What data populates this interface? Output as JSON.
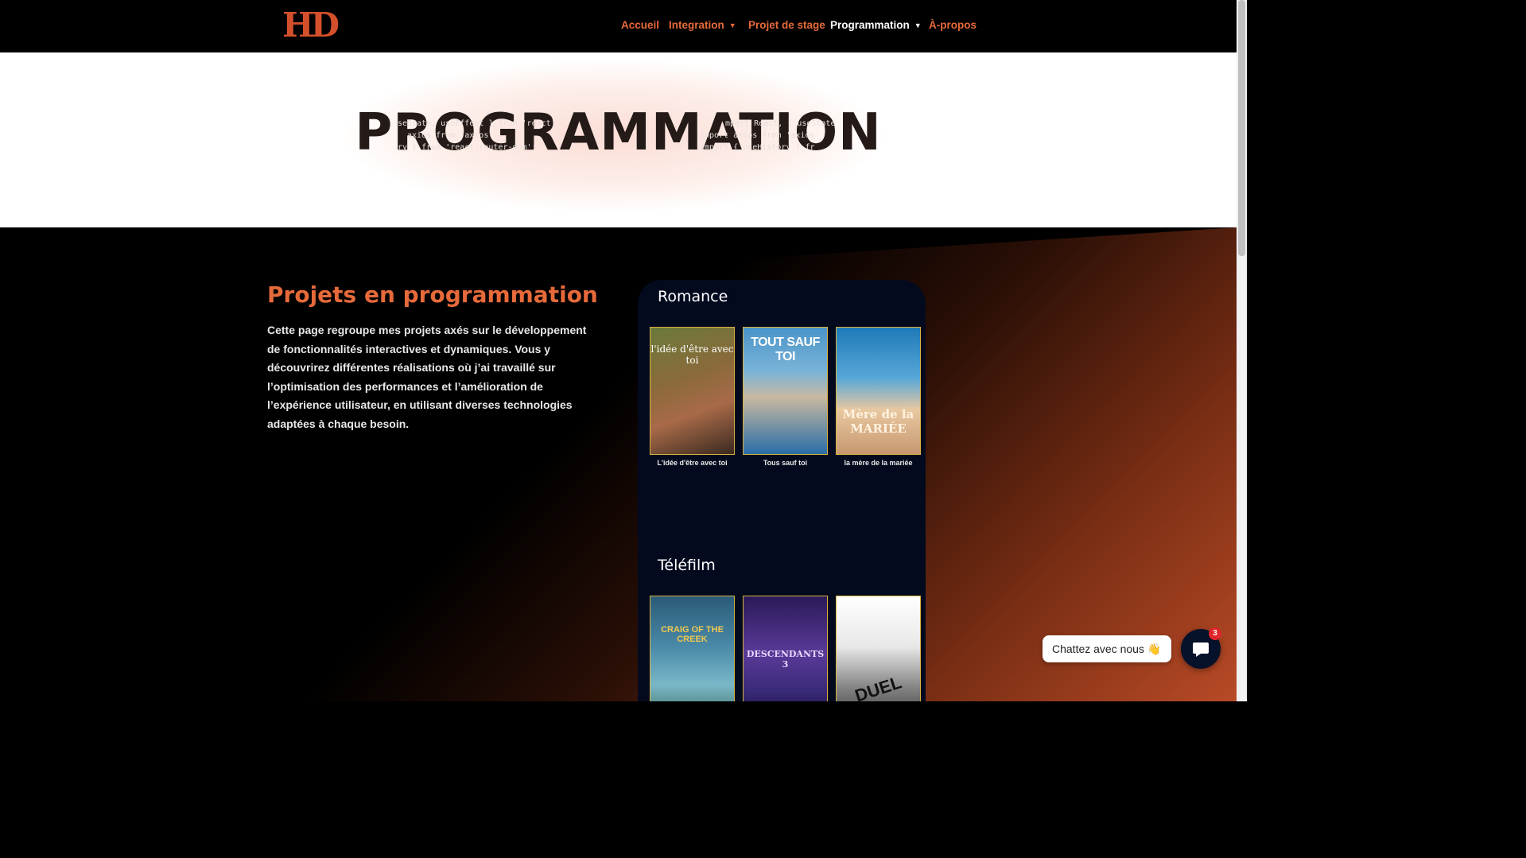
{
  "header": {
    "logo": "HD",
    "nav": [
      {
        "label": "Accueil",
        "has_dropdown": false,
        "active": false
      },
      {
        "label": "Integration",
        "has_dropdown": true,
        "active": false
      },
      {
        "label": "Projet de stage",
        "has_dropdown": false,
        "active": false
      },
      {
        "label": "Programmation",
        "has_dropdown": true,
        "active": true
      },
      {
        "label": "À-propos",
        "has_dropdown": false,
        "active": false
      }
    ]
  },
  "hero": {
    "title": "PROGRAMMATION",
    "code_lines": [
      "seState, useEffect } from 'react'",
      "axios from 'axios'",
      "ry } from 'react-router-dom';",
      "mport React, { useState",
      "import axios from 'axios'",
      "import { useHistory } fr"
    ]
  },
  "section": {
    "title": "Projets en programmation",
    "description": "Cette page regroupe mes projets axés sur le développement de fonctionnalités interactives et dynamiques. Vous y découvrirez différentes réalisations où j’ai travaillé sur l’optimisation des performances et l’amélioration de l’expérience utilisateur, en utilisant diverses technologies adaptées à chaque besoin."
  },
  "card": {
    "genres": [
      {
        "name": "Romance",
        "movies": [
          {
            "caption": "L'idée d'être avec toi",
            "poster_text": "l'idée d'être avec toi"
          },
          {
            "caption": "Tous sauf toi",
            "poster_text": "TOUT SAUF TOI"
          },
          {
            "caption": "la mère de la mariée",
            "poster_text": "Mère de la MARIÉE"
          }
        ]
      },
      {
        "name": "Téléfilm",
        "movies": [
          {
            "caption": "",
            "poster_text": "CRAIG OF THE CREEK"
          },
          {
            "caption": "",
            "poster_text": "DESCENDANTS 3"
          },
          {
            "caption": "",
            "poster_text": "DUEL"
          }
        ]
      }
    ]
  },
  "chat": {
    "label": "Chattez avec nous",
    "emoji": "👋",
    "badge_count": "3"
  },
  "colors": {
    "accent": "#e66a3a",
    "header_bg": "#000000",
    "card_bg": "#040a1e",
    "poster_border": "#d8b23c"
  }
}
